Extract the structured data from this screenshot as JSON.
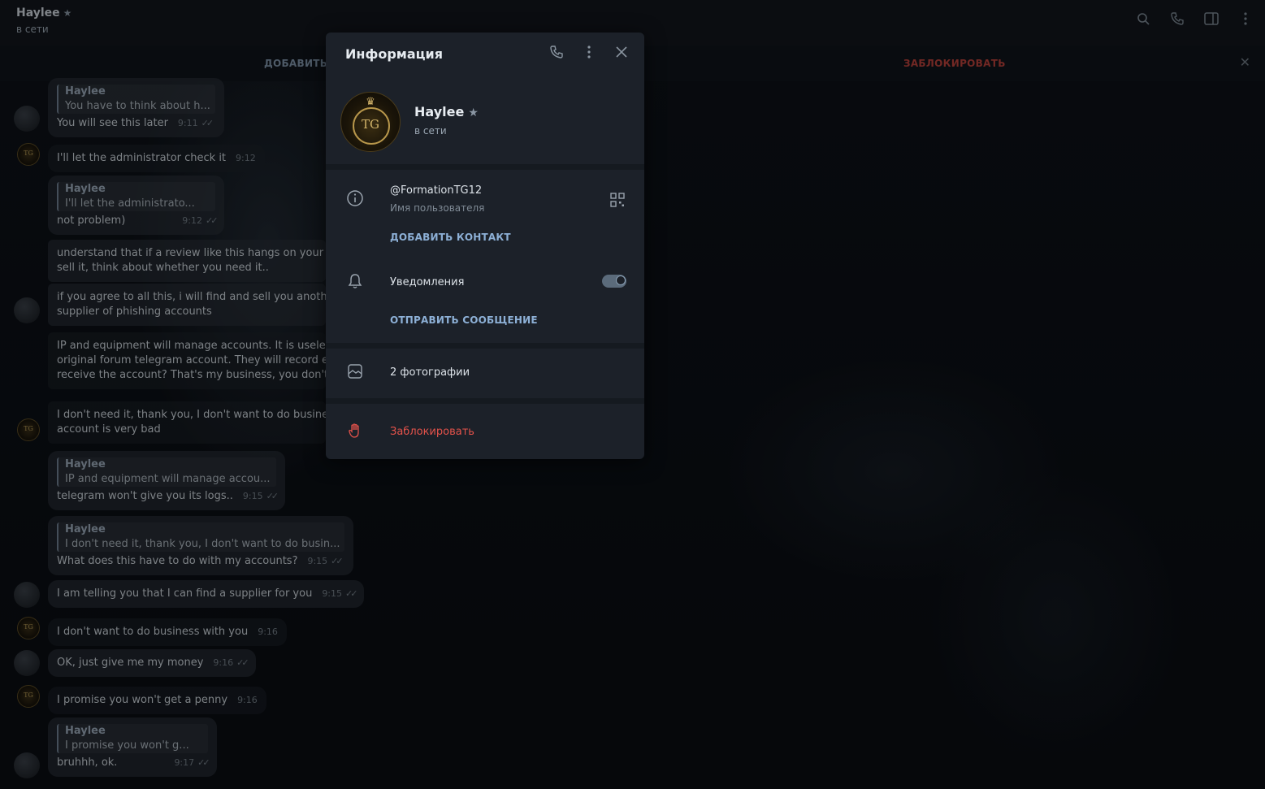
{
  "chat": {
    "title": "Haylee",
    "status": "в сети",
    "add_contact": "ДОБАВИТЬ I",
    "block": "ЗАБЛОКИРОВАТЬ"
  },
  "messages": [
    {
      "quote_name": "Haylee",
      "quote_text": "You have to think about h...",
      "text": "You will see this later",
      "time": "9:11"
    },
    {
      "text": "I'll let the administrator check it",
      "time": "9:12"
    },
    {
      "quote_name": "Haylee",
      "quote_text": "I'll let the administrato...",
      "text": "not problem)",
      "time": "9:12"
    },
    {
      "line1": "understand that if a review like this hangs on your topic",
      "line2": "sell it, think about whether you need it.."
    },
    {
      "line1": "if you agree to all this, i will find and sell you another per",
      "line2": "supplier of phishing accounts"
    },
    {
      "line1": "IP and equipment will manage accounts. It is useless to r",
      "line2": "original forum telegram account. They will record everyt",
      "line3": "receive the account? That's my business, you don't have"
    },
    {
      "line1": "I don't need it, thank you, I don't want to do business w",
      "line2": "account is very bad"
    },
    {
      "quote_name": "Haylee",
      "quote_text": "IP and equipment will manage accou...",
      "text": "telegram won't give you its logs..",
      "time": "9:15"
    },
    {
      "quote_name": "Haylee",
      "quote_text": "I don't need it, thank you, I don't want to do busin...",
      "text": "What does this have to do with my accounts?",
      "time": "9:15"
    },
    {
      "text": "I am telling you that I can find a supplier for you",
      "time": "9:15"
    },
    {
      "text": "I don't want to do business with you",
      "time": "9:16"
    },
    {
      "text": "OK, just give me my money",
      "time": "9:16"
    },
    {
      "text": "I promise you won't get a penny",
      "time": "9:16"
    },
    {
      "quote_name": "Haylee",
      "quote_text": "I promise you won't g...",
      "text": "bruhhh, ok.",
      "time": "9:17"
    }
  ],
  "panel": {
    "title": "Информация",
    "name": "Haylee",
    "status": "в сети",
    "avatar_text": "TG",
    "username": "@FormationTG12",
    "username_label": "Имя пользователя",
    "add_contact": "ДОБАВИТЬ КОНТАКТ",
    "notifications": "Уведомления",
    "send_message": "ОТПРАВИТЬ СООБЩЕНИЕ",
    "photos": "2 фотографии",
    "block": "Заблокировать"
  }
}
